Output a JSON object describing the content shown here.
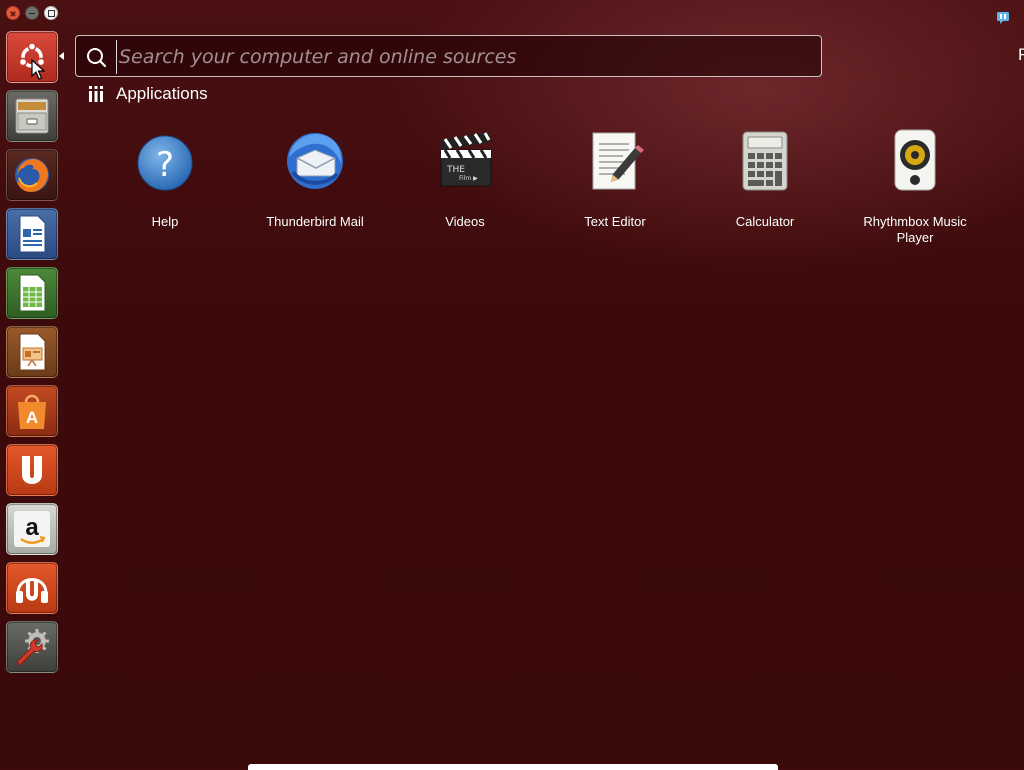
{
  "search": {
    "placeholder": "Search your computer and online sources"
  },
  "category": {
    "title": "Applications"
  },
  "top_right": {
    "partial_letter": "F"
  },
  "launcher": {
    "items": [
      {
        "name": "dash-home",
        "icon": "ubuntu-logo-icon"
      },
      {
        "name": "files",
        "icon": "file-cabinet-icon"
      },
      {
        "name": "firefox",
        "icon": "firefox-icon"
      },
      {
        "name": "writer",
        "icon": "document-icon"
      },
      {
        "name": "calc",
        "icon": "spreadsheet-icon"
      },
      {
        "name": "impress",
        "icon": "presentation-icon"
      },
      {
        "name": "software-center",
        "icon": "shopping-bag-icon"
      },
      {
        "name": "ubuntu-one",
        "icon": "ubuntu-one-icon"
      },
      {
        "name": "amazon",
        "icon": "amazon-icon"
      },
      {
        "name": "ubuntu-one-music",
        "icon": "headphones-icon"
      },
      {
        "name": "system-settings",
        "icon": "wrench-gear-icon"
      }
    ]
  },
  "apps": [
    {
      "label": "Help",
      "icon": "help-icon"
    },
    {
      "label": "Thunderbird Mail",
      "icon": "thunderbird-icon"
    },
    {
      "label": "Videos",
      "icon": "clapperboard-icon"
    },
    {
      "label": "Text Editor",
      "icon": "text-editor-icon"
    },
    {
      "label": "Calculator",
      "icon": "calculator-icon"
    },
    {
      "label": "Rhythmbox Music Player",
      "icon": "speaker-icon"
    }
  ],
  "colors": {
    "background": "#3f0b0c",
    "accent_orange": "#e95420"
  }
}
